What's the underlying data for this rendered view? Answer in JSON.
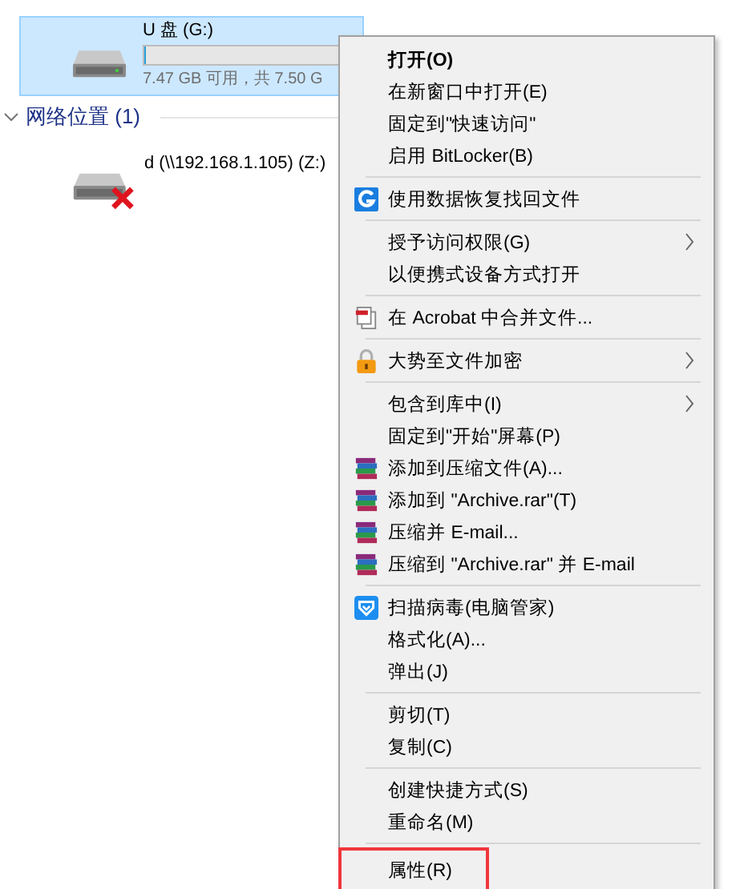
{
  "drive": {
    "name": "U 盘 (G:)",
    "level": 0.004,
    "space": "7.47 GB 可用，共 7.50 G",
    "selected": true
  },
  "section": {
    "title": "网络位置 (1)",
    "expanded": true
  },
  "network_drive": {
    "name": "d (\\\\192.168.1.105) (Z:)",
    "disconnected": true
  },
  "context_menu": {
    "groups": [
      {
        "items": [
          {
            "label": "打开(O)",
            "bold": true
          },
          {
            "label": "在新窗口中打开(E)"
          },
          {
            "label": "固定到\"快速访问\""
          },
          {
            "label": "启用 BitLocker(B)"
          }
        ]
      },
      {
        "items": [
          {
            "label": "使用数据恢复找回文件",
            "kind": "recover"
          }
        ]
      },
      {
        "items": [
          {
            "label": "授予访问权限(G)",
            "submenu": true
          },
          {
            "label": "以便携式设备方式打开"
          }
        ]
      },
      {
        "items": [
          {
            "label": "在 Acrobat 中合并文件...",
            "kind": "acrobat"
          }
        ]
      },
      {
        "items": [
          {
            "label": "大势至文件加密",
            "kind": "lock",
            "submenu": true
          }
        ]
      },
      {
        "items": [
          {
            "label": "包含到库中(I)",
            "submenu": true
          },
          {
            "label": "固定到\"开始\"屏幕(P)"
          },
          {
            "label": "添加到压缩文件(A)...",
            "kind": "rar"
          },
          {
            "label": "添加到 \"Archive.rar\"(T)",
            "kind": "rar"
          },
          {
            "label": "压缩并 E-mail...",
            "kind": "rar"
          },
          {
            "label": "压缩到 \"Archive.rar\" 并 E-mail",
            "kind": "rar"
          }
        ]
      },
      {
        "items": [
          {
            "label": "扫描病毒(电脑管家)",
            "kind": "shield"
          },
          {
            "label": "格式化(A)..."
          },
          {
            "label": "弹出(J)"
          }
        ]
      },
      {
        "items": [
          {
            "label": "剪切(T)"
          },
          {
            "label": "复制(C)"
          }
        ]
      },
      {
        "items": [
          {
            "label": "创建快捷方式(S)"
          },
          {
            "label": "重命名(M)"
          }
        ]
      },
      {
        "items": [
          {
            "label": "属性(R)",
            "highlighted": true
          }
        ]
      }
    ]
  }
}
